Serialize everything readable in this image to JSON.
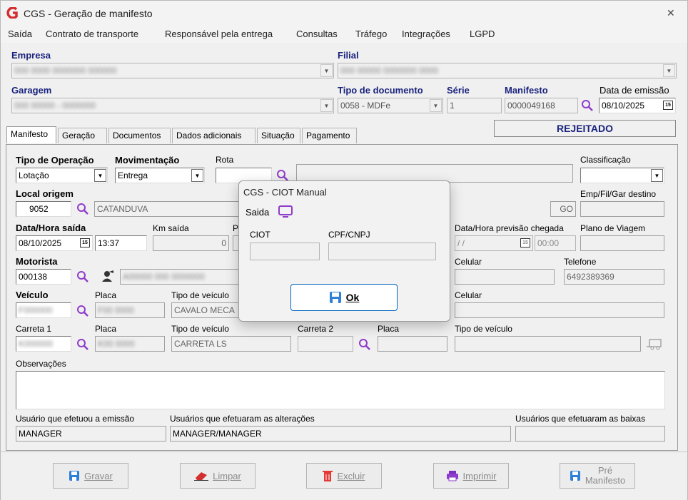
{
  "window": {
    "title": "CGS - Geração de manifesto",
    "close": "✕"
  },
  "menu": [
    "Saída",
    "Contrato de transporte",
    "Responsável pela entrega",
    "Consultas",
    "Tráfego",
    "Integrações",
    "LGPD"
  ],
  "header": {
    "empresa_label": "Empresa",
    "filial_label": "Filial",
    "garagem_label": "Garagem",
    "tipo_doc_label": "Tipo de documento",
    "tipo_doc_value": "0058 - MDFe",
    "serie_label": "Série",
    "serie_value": "1",
    "manifesto_label": "Manifesto",
    "manifesto_value": "0000049168",
    "data_emissao_label": "Data de emissão",
    "data_emissao_value": "08/10/2025"
  },
  "tabs": [
    "Manifesto",
    "Geração",
    "Documentos",
    "Dados adicionais",
    "Situação",
    "Pagamento"
  ],
  "status": "REJEITADO",
  "form": {
    "tipo_operacao_label": "Tipo de Operação",
    "tipo_operacao_value": "Lotação",
    "movimentacao_label": "Movimentação",
    "movimentacao_value": "Entrega",
    "rota_label": "Rota",
    "classificacao_label": "Classificação",
    "local_origem_label": "Local origem",
    "local_origem_code": "9052",
    "local_origem_city": "CATANDUVA",
    "uf": "GO",
    "emp_destino_label": "Emp/Fil/Gar destino",
    "data_saida_label": "Data/Hora saída",
    "data_saida_value": "08/10/2025",
    "hora_saida_value": "13:37",
    "km_saida_label": "Km saída",
    "km_saida_value": "0",
    "p_label": "P",
    "previsao_label": "Data/Hora previsão chegada",
    "previsao_date": " / /",
    "previsao_time": "00:00",
    "plano_label": "Plano de Viagem",
    "motorista_label": "Motorista",
    "motorista_value": "000138",
    "celular_label": "Celular",
    "telefone_label": "Telefone",
    "telefone_value": "6492389369",
    "veiculo_label": "Veículo",
    "placa_label": "Placa",
    "tipo_veiculo_label": "Tipo de veículo",
    "veiculo_tipo_value": "CAVALO MECA",
    "celular2_label": "Celular",
    "carreta1_label": "Carreta 1",
    "carreta1_tipo_value": "CARRETA LS",
    "carreta2_label": "Carreta 2",
    "observacoes_label": "Observações",
    "usuario_emissao_label": "Usuário que efetuou a emissão",
    "usuario_emissao_value": "MANAGER",
    "usuarios_alteracoes_label": "Usuários que efetuaram as alterações",
    "usuarios_alteracoes_value": "MANAGER/MANAGER",
    "usuarios_baixas_label": "Usuários que efetuaram as baixas"
  },
  "buttons": {
    "gravar": "Gravar",
    "limpar": "Limpar",
    "excluir": "Excluir",
    "imprimir": "Imprimir",
    "pre_manifesto_1": "Pré",
    "pre_manifesto_2": "Manifesto"
  },
  "dialog": {
    "title": "CGS - CIOT Manual",
    "menu": "Saida",
    "ciot_label": "CIOT",
    "cpf_label": "CPF/CNPJ",
    "ok_label": "Ok"
  },
  "colors": {
    "accent": "#1a237e",
    "icon_purple": "#8e3ccb",
    "ok_border": "#0067c0"
  }
}
